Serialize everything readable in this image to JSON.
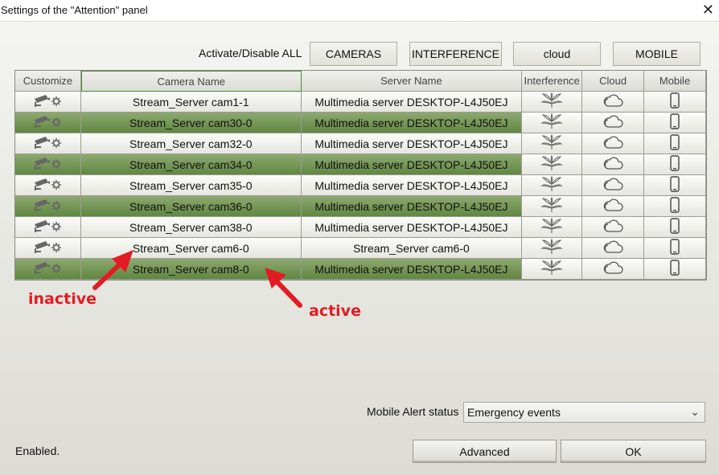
{
  "window": {
    "title": "Settings of the \"Attention\" panel",
    "close_icon": "close-icon"
  },
  "toolbar": {
    "activate_label": "Activate/Disable ALL",
    "cameras": "CAMERAS",
    "interference": "INTERFERENCE",
    "cloud": "cloud",
    "mobile": "MOBILE"
  },
  "table": {
    "headers": [
      "Customize",
      "Camera Name",
      "Server Name",
      "Interference",
      "Cloud",
      "Mobile"
    ],
    "rows": [
      {
        "camera": "Stream_Server cam1-1",
        "server": "Multimedia server DESKTOP-L4J50EJ",
        "state": "inactive"
      },
      {
        "camera": "Stream_Server cam30-0",
        "server": "Multimedia server DESKTOP-L4J50EJ",
        "state": "active"
      },
      {
        "camera": "Stream_Server cam32-0",
        "server": "Multimedia server DESKTOP-L4J50EJ",
        "state": "inactive"
      },
      {
        "camera": "Stream_Server cam34-0",
        "server": "Multimedia server DESKTOP-L4J50EJ",
        "state": "active"
      },
      {
        "camera": "Stream_Server cam35-0",
        "server": "Multimedia server DESKTOP-L4J50EJ",
        "state": "inactive"
      },
      {
        "camera": "Stream_Server cam36-0",
        "server": "Multimedia server DESKTOP-L4J50EJ",
        "state": "active"
      },
      {
        "camera": "Stream_Server cam38-0",
        "server": "Multimedia server DESKTOP-L4J50EJ",
        "state": "inactive"
      },
      {
        "camera": "Stream_Server cam6-0",
        "server": "Stream_Server cam6-0",
        "state": "inactive"
      },
      {
        "camera": "Stream_Server cam8-0",
        "server": "Multimedia server DESKTOP-L4J50EJ",
        "state": "active"
      }
    ],
    "icons": {
      "customize": "camera-gear-icon",
      "interference": "tree-icon",
      "cloud": "cloud-icon",
      "mobile": "phone-icon"
    }
  },
  "annotations": {
    "inactive": "inactive",
    "active": "active",
    "color": "#e31b23"
  },
  "mobile_alert": {
    "label": "Mobile Alert status",
    "value": "Emergency events"
  },
  "footer": {
    "status": "Enabled.",
    "advanced": "Advanced",
    "ok": "OK"
  },
  "colors": {
    "active_row": "#6f9650",
    "header_selected_border": "#4b8a3b"
  }
}
